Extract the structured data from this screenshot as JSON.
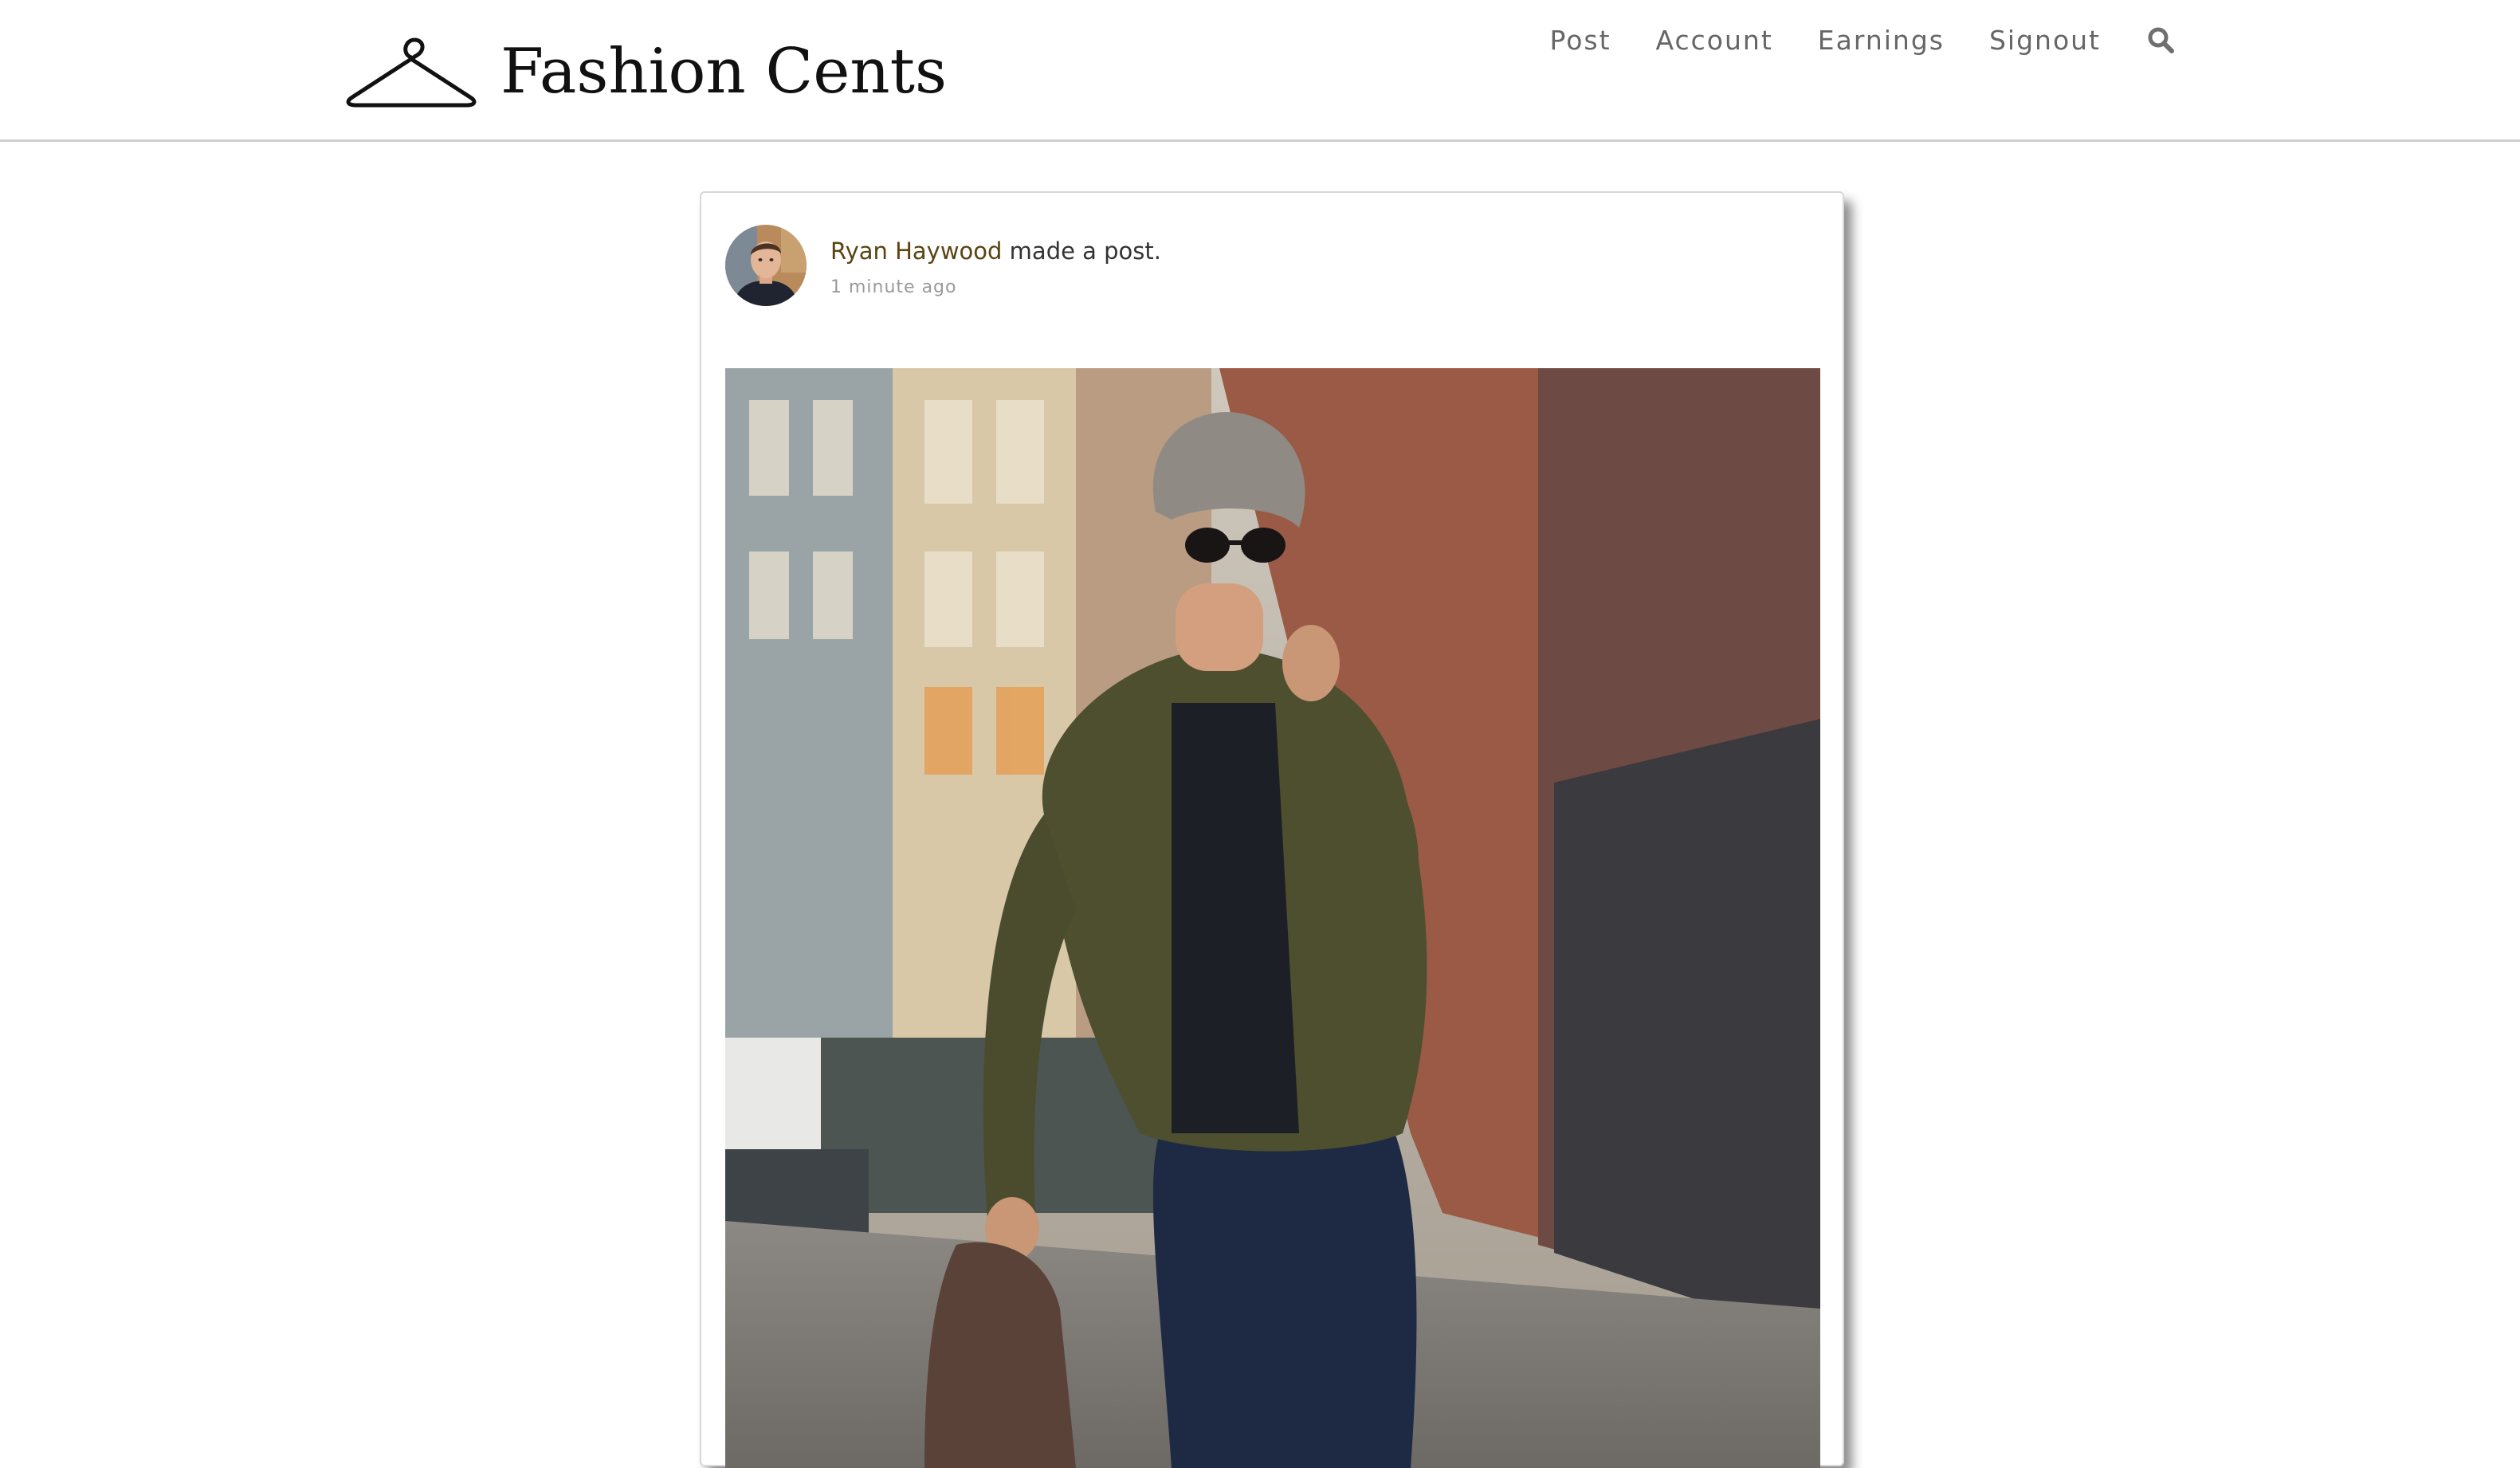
{
  "header": {
    "brand": "Fashion Cents",
    "nav": [
      "Post",
      "Account",
      "Earnings",
      "Signout"
    ],
    "icons": {
      "logo": "hanger-icon",
      "search": "search-icon"
    }
  },
  "post": {
    "author": "Ryan Haywood",
    "action": "made a post.",
    "timestamp": "1 minute ago",
    "avatar": "avatar",
    "image": "street-fashion-photo"
  },
  "colors": {
    "author_link": "#5a4311",
    "nav_text": "#666666",
    "header_border": "#cfcfcf"
  }
}
